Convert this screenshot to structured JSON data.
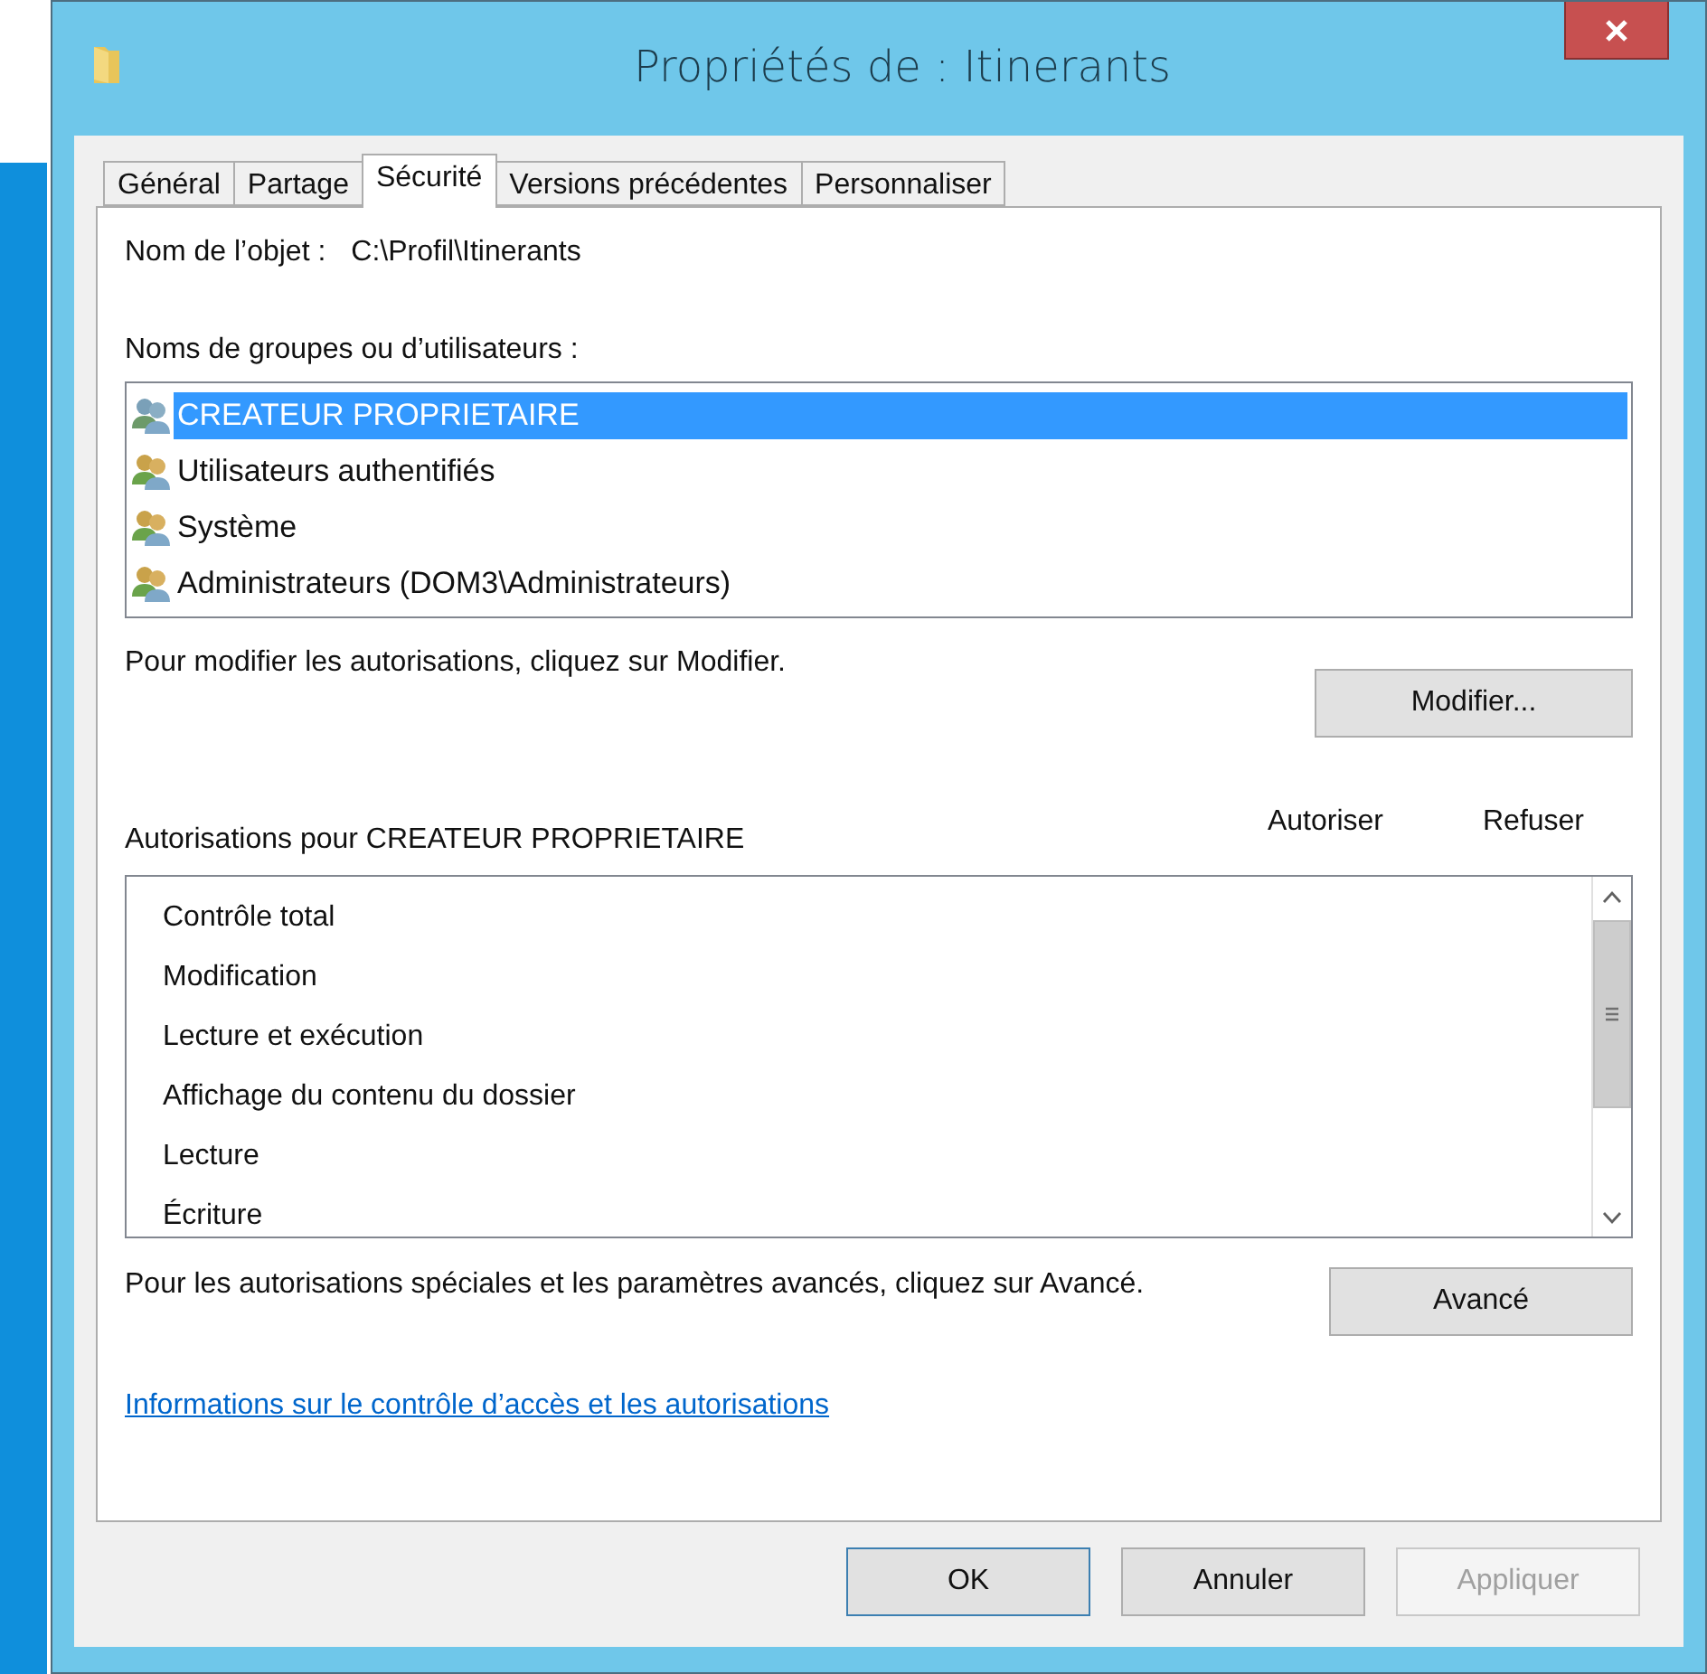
{
  "window": {
    "title": "Propriétés de : Itinerants"
  },
  "tabs": [
    {
      "label": "Général",
      "selected": false
    },
    {
      "label": "Partage",
      "selected": false
    },
    {
      "label": "Sécurité",
      "selected": true
    },
    {
      "label": "Versions précédentes",
      "selected": false
    },
    {
      "label": "Personnaliser",
      "selected": false
    }
  ],
  "object": {
    "label": "Nom de l’objet :",
    "value": "C:\\Profil\\Itinerants"
  },
  "groups": {
    "label": "Noms de groupes ou d’utilisateurs :",
    "items": [
      {
        "name": "CREATEUR PROPRIETAIRE",
        "selected": true
      },
      {
        "name": "Utilisateurs authentifiés",
        "selected": false
      },
      {
        "name": "Système",
        "selected": false
      },
      {
        "name": "Administrateurs (DOM3\\Administrateurs)",
        "selected": false
      }
    ]
  },
  "modify": {
    "hint": "Pour modifier les autorisations, cliquez sur Modifier.",
    "button": "Modifier..."
  },
  "permissions": {
    "label": "Autorisations pour CREATEUR PROPRIETAIRE",
    "columns": [
      "Autoriser",
      "Refuser"
    ],
    "items": [
      "Contrôle total",
      "Modification",
      "Lecture et exécution",
      "Affichage du contenu du dossier",
      "Lecture",
      "Écriture"
    ]
  },
  "advanced": {
    "hint": "Pour les autorisations spéciales et les paramètres avancés, cliquez sur Avancé.",
    "button": "Avancé"
  },
  "link": "Informations sur le contrôle d’accès et les autorisations",
  "buttons": [
    {
      "label": "OK",
      "disabled": false,
      "default": true
    },
    {
      "label": "Annuler",
      "disabled": false,
      "default": false
    },
    {
      "label": "Appliquer",
      "disabled": true,
      "default": false
    }
  ]
}
